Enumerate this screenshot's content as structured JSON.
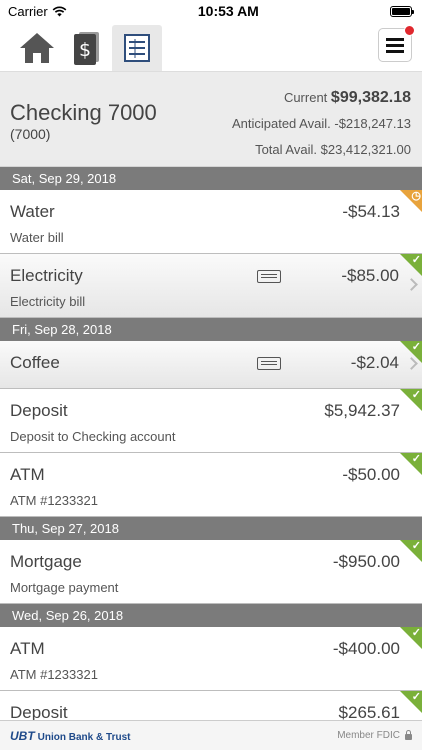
{
  "status_bar": {
    "carrier": "Carrier",
    "time": "10:53 AM"
  },
  "toolbar": {
    "tabs": [
      {
        "icon": "home-icon",
        "active": false
      },
      {
        "icon": "dollar-cards-icon",
        "active": false
      },
      {
        "icon": "ledger-icon",
        "active": true
      }
    ],
    "menu_icon": "hamburger-icon",
    "notification_color": "#e0282e"
  },
  "account": {
    "name": "Checking 7000",
    "number": "(7000)",
    "current_label": "Current",
    "current_value": "$99,382.18",
    "anticipated_label": "Anticipated Avail.",
    "anticipated_value": "-$218,247.13",
    "total_label": "Total Avail.",
    "total_value": "$23,412,321.00"
  },
  "groups": [
    {
      "date": "Sat, Sep 29, 2018",
      "transactions": [
        {
          "name": "Water",
          "description": "Water bill",
          "amount": "-$54.13",
          "status": "pending"
        },
        {
          "name": "Electricity",
          "description": "Electricity bill",
          "amount": "-$85.00",
          "status": "cleared"
        }
      ]
    },
    {
      "date": "Fri, Sep 28, 2018",
      "transactions": [
        {
          "name": "Coffee",
          "description": "",
          "amount": "-$2.04",
          "status": "cleared"
        },
        {
          "name": "Deposit",
          "description": "Deposit to Checking account",
          "amount": "$5,942.37",
          "status": "cleared"
        },
        {
          "name": "ATM",
          "description": "ATM #1233321",
          "amount": "-$50.00",
          "status": "cleared"
        }
      ]
    },
    {
      "date": "Thu, Sep 27, 2018",
      "transactions": [
        {
          "name": "Mortgage",
          "description": "Mortgage payment",
          "amount": "-$950.00",
          "status": "cleared"
        }
      ]
    },
    {
      "date": "Wed, Sep 26, 2018",
      "transactions": [
        {
          "name": "ATM",
          "description": "ATM #1233321",
          "amount": "-$400.00",
          "status": "cleared"
        },
        {
          "name": "Deposit",
          "description": "",
          "amount": "$265.61",
          "status": "cleared"
        }
      ]
    }
  ],
  "footer": {
    "logo_mark": "UBT",
    "logo_text": "Union Bank & Trust",
    "fdic": "Member FDIC"
  },
  "colors": {
    "cleared": "#7ab03a",
    "pending": "#e8a33c",
    "date_header": "#7b7b7b",
    "brand": "#1f4a8a"
  }
}
